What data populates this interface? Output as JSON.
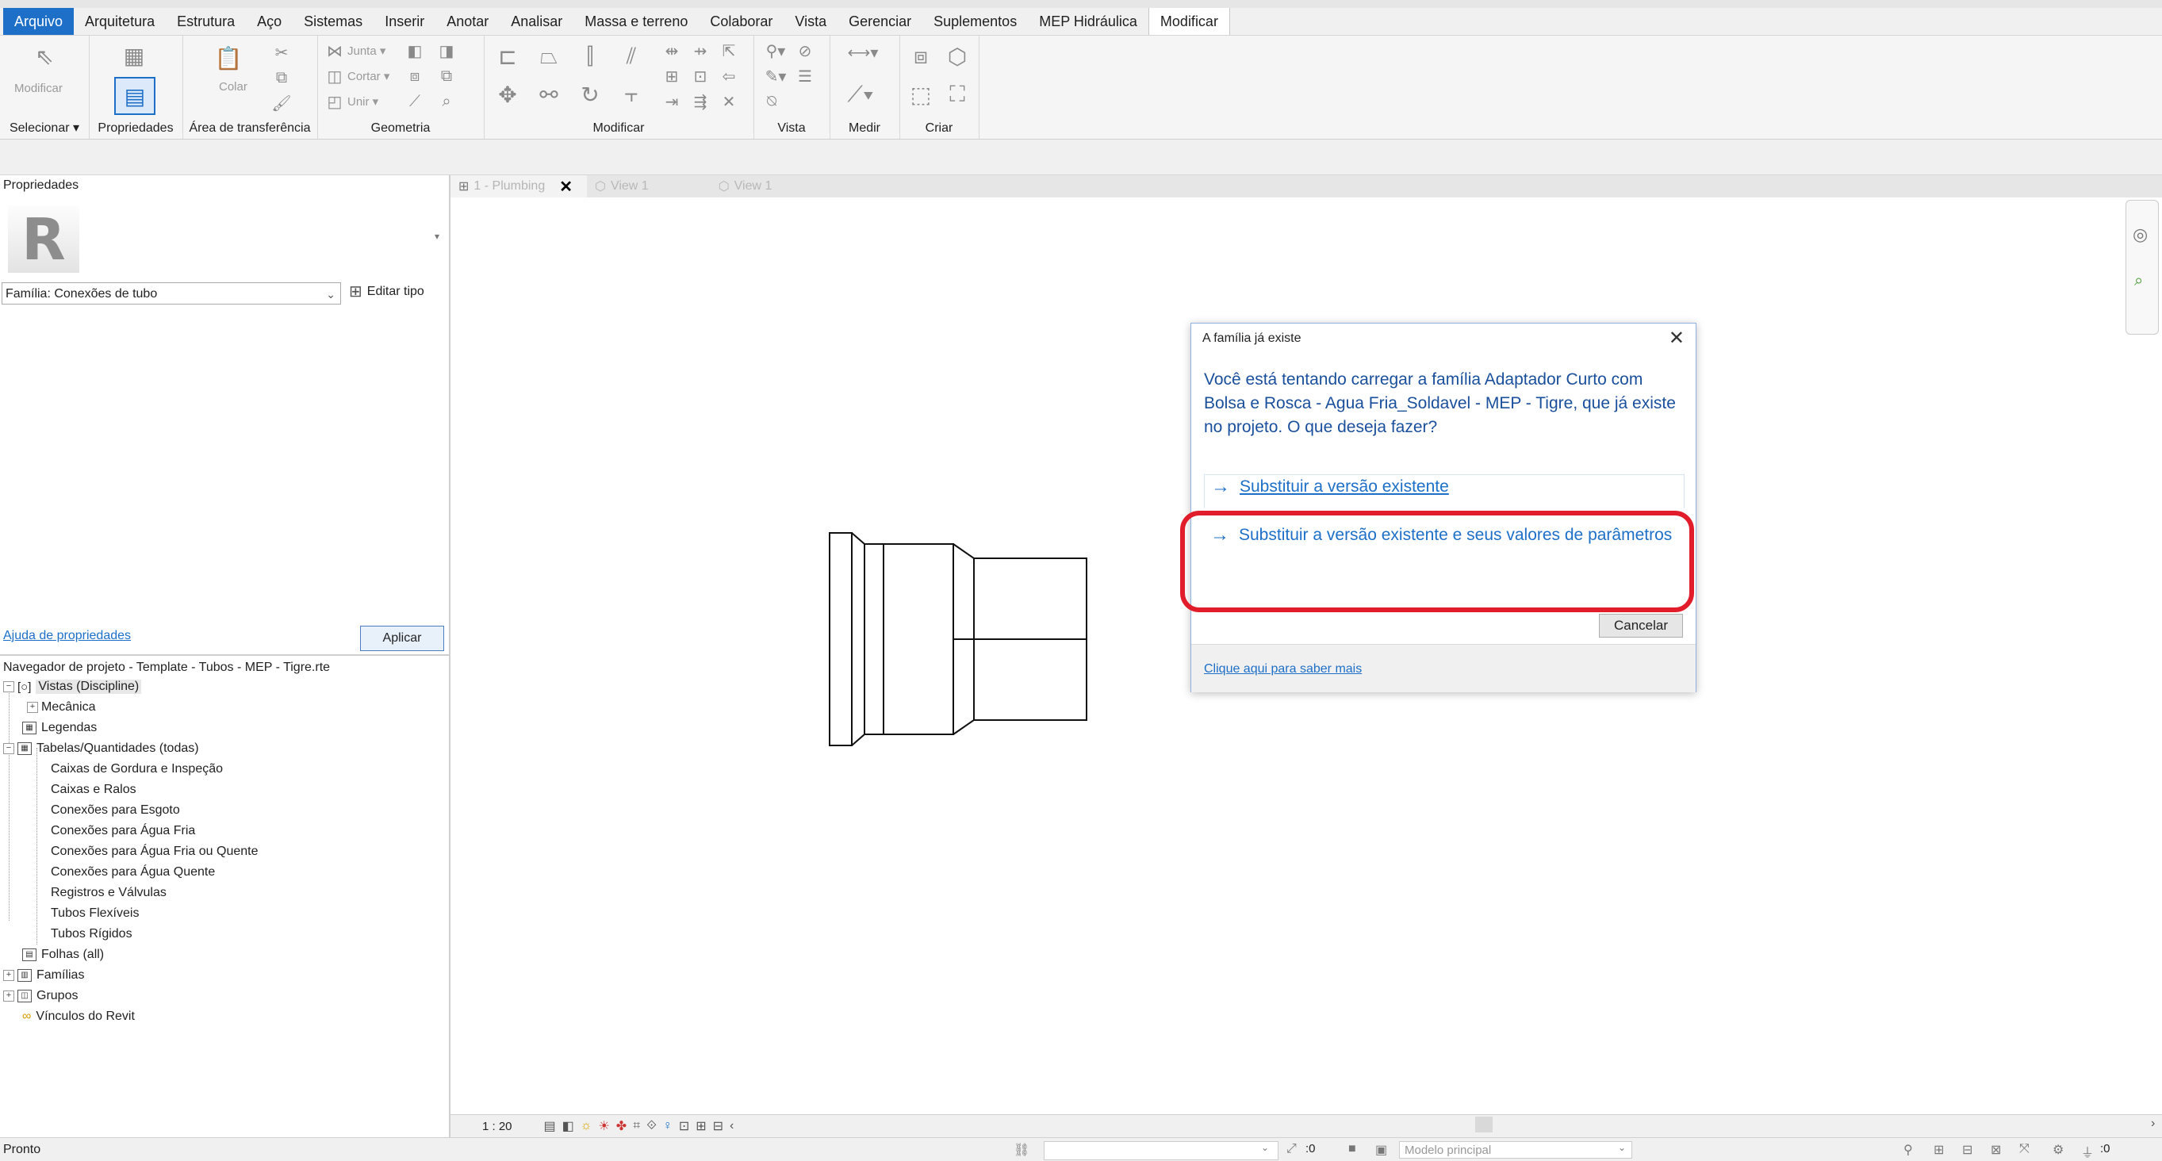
{
  "menu": {
    "items": [
      "Arquivo",
      "Arquitetura",
      "Estrutura",
      "Aço",
      "Sistemas",
      "Inserir",
      "Anotar",
      "Analisar",
      "Massa e terreno",
      "Colaborar",
      "Vista",
      "Gerenciar",
      "Suplementos",
      "MEP Hidráulica",
      "Modificar"
    ],
    "active": "Modificar",
    "accent_color": "#1d6fc7"
  },
  "ribbon": {
    "modify_label": "Modificar",
    "select_label": "Selecionar ▾",
    "properties_label": "Propriedades",
    "clipboard_label": "Área de transferência",
    "paste_label": "Colar",
    "geometry_label": "Geometria",
    "join_label": "Junta ▾",
    "cut_label": "Cortar ▾",
    "unite_label": "Unir ▾",
    "modify_group_label": "Modificar",
    "view_label": "Vista",
    "measure_label": "Medir",
    "create_label": "Criar"
  },
  "properties": {
    "title": "Propriedades",
    "logo_letter": "R",
    "family_value": "Família: Conexões de tubo",
    "edit_type_label": "Editar tipo",
    "help_link": "Ajuda de propriedades",
    "apply_label": "Aplicar"
  },
  "navigator": {
    "title": "Navegador de projeto - Template - Tubos - MEP - Tigre.rte",
    "views": "Vistas (Discipline)",
    "mechanical": "Mecânica",
    "legends": "Legendas",
    "schedules": "Tabelas/Quantidades (todas)",
    "schedule_items": [
      "Caixas de Gordura e Inspeção",
      "Caixas e Ralos",
      "Conexões para Esgoto",
      "Conexões para Água Fria",
      "Conexões para Água Fria ou Quente",
      "Conexões para Água Quente",
      "Registros e Válvulas",
      "Tubos Flexíveis",
      "Tubos Rígidos"
    ],
    "sheets": "Folhas (all)",
    "families": "Famílias",
    "groups": "Grupos",
    "revit_links": "Vínculos do Revit"
  },
  "tabs": [
    {
      "label": "1 - Plumbing",
      "close": "✕"
    },
    {
      "label": "View 1"
    },
    {
      "label": "View 1"
    }
  ],
  "viewbar": {
    "scale": "1 : 20"
  },
  "status": {
    "text": "Pronto",
    "zero_label": ":0",
    "model": "Modelo principal",
    "filter_count": ":0"
  },
  "dialog": {
    "title": "A família já existe",
    "close": "✕",
    "message": "Você está tentando carregar a família Adaptador Curto com Bolsa e Rosca - Agua Fria_Soldavel - MEP - Tigre, que já existe no projeto. O que deseja fazer?",
    "option1": "Substituir a versão existente",
    "option2": "Substituir a versão existente e seus valores de parâmetros",
    "arrow": "→",
    "cancel": "Cancelar",
    "learn_more": "Clique aqui para saber mais",
    "highlight_color": "#e21d2b"
  }
}
